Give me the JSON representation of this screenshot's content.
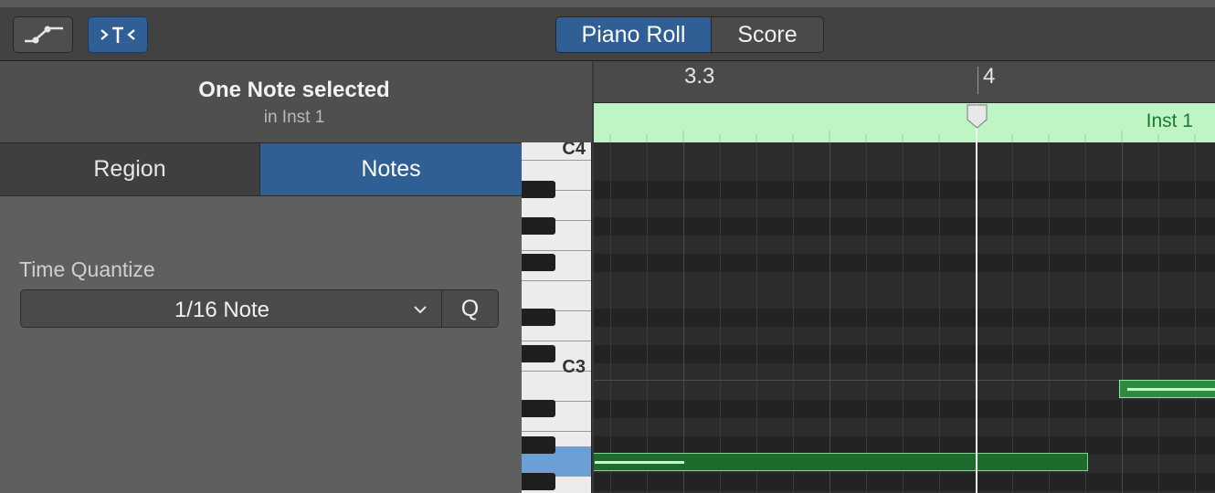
{
  "toolbar": {
    "automation_icon": "automation-curve-icon",
    "midi_filter_icon": "midi-in-filter-icon",
    "views": [
      {
        "label": "Piano Roll",
        "selected": true
      },
      {
        "label": "Score",
        "selected": false
      }
    ]
  },
  "inspector": {
    "selection_title": "One Note selected",
    "selection_subtitle": "in Inst 1",
    "tabs": [
      {
        "label": "Region",
        "selected": false
      },
      {
        "label": "Notes",
        "selected": true
      }
    ],
    "time_quantize": {
      "label": "Time Quantize",
      "value": "1/16 Note",
      "quantize_button": "Q"
    }
  },
  "ruler": {
    "marks": [
      "3.3",
      "4"
    ]
  },
  "region": {
    "name": "Inst 1",
    "color": "#bff5c4"
  },
  "keyboard": {
    "labels": [
      "C4",
      "C3"
    ]
  },
  "colors": {
    "accent": "#2f5f94",
    "note": "#2e8a3e",
    "note_border": "#8be59a"
  }
}
